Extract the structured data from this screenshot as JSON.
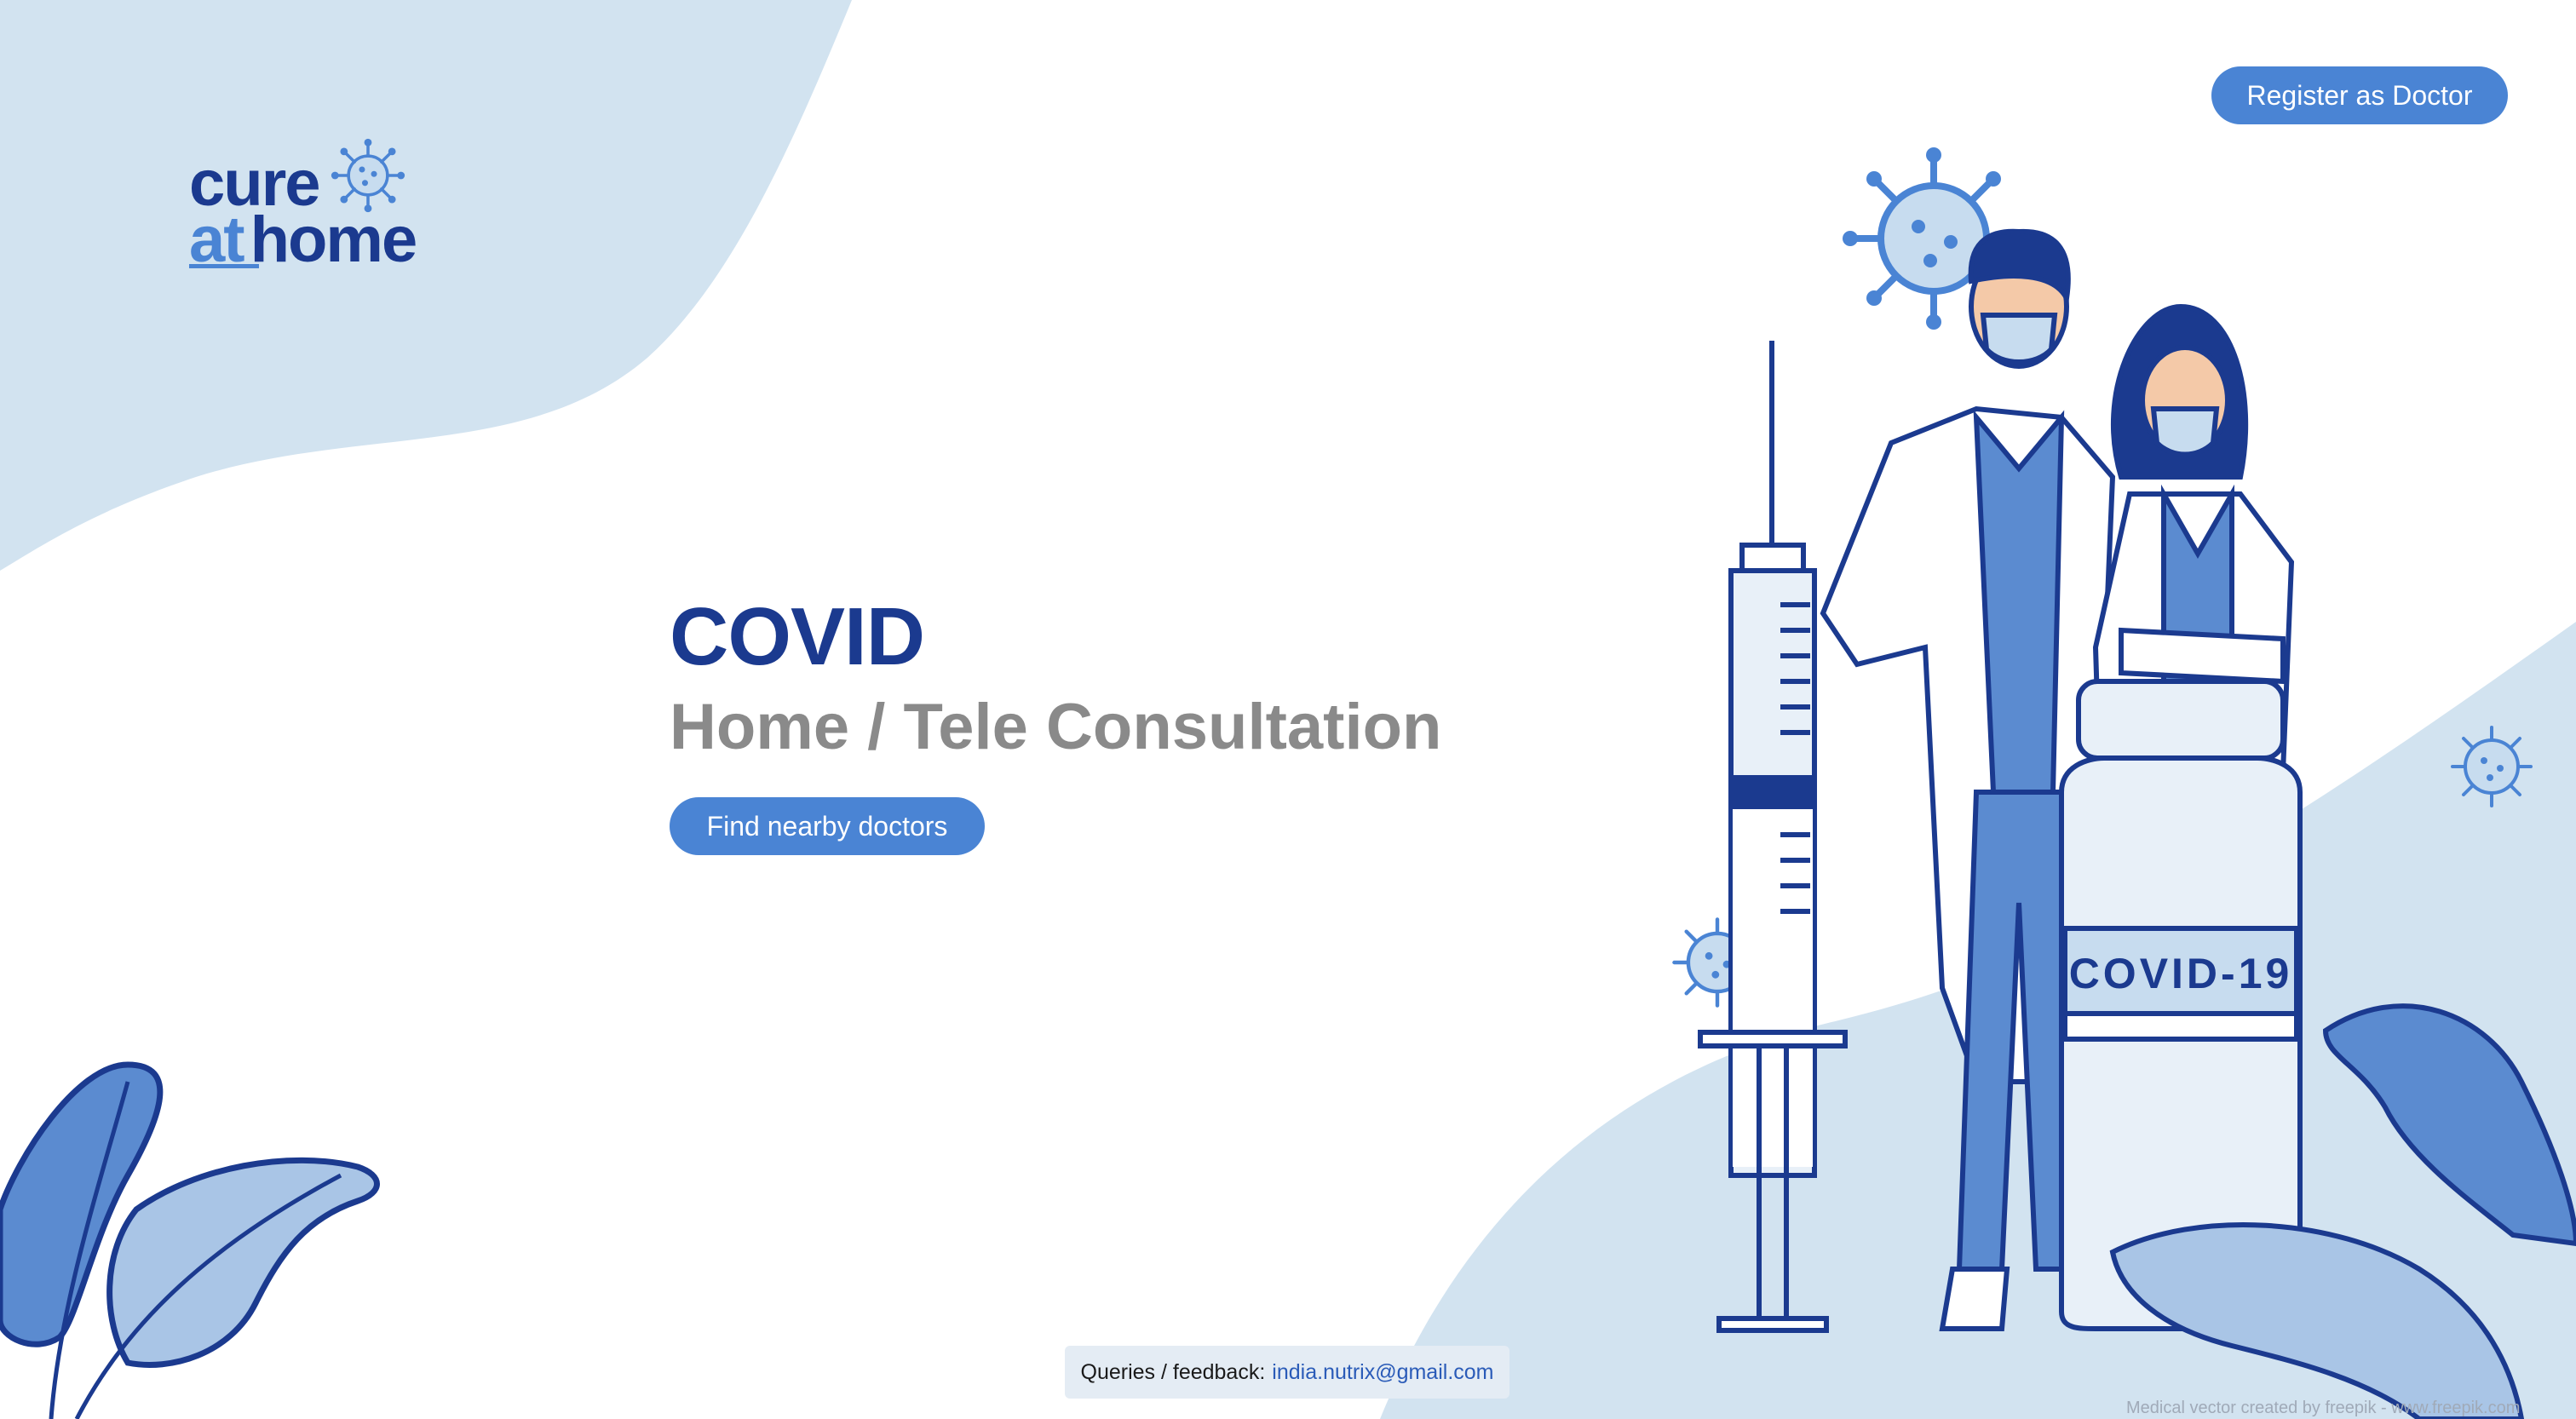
{
  "brand": {
    "line1": "cure",
    "at": "at",
    "home": "home"
  },
  "header": {
    "register_label": "Register as Doctor"
  },
  "hero": {
    "title": "COVID",
    "subtitle": "Home / Tele Consultation",
    "cta_label": "Find nearby doctors"
  },
  "illustration": {
    "vial_label": "COVID-19"
  },
  "footer": {
    "queries_label": "Queries / feedback:",
    "email": "india.nutrix@gmail.com",
    "credit": "Medical vector created by freepik - www.freepik.com"
  },
  "colors": {
    "primary": "#4a84d4",
    "navy": "#1b3a8f",
    "blob": "#d2e3f0",
    "subtitle_gray": "#8a8a8a"
  },
  "icons": [
    "virus-icon"
  ]
}
